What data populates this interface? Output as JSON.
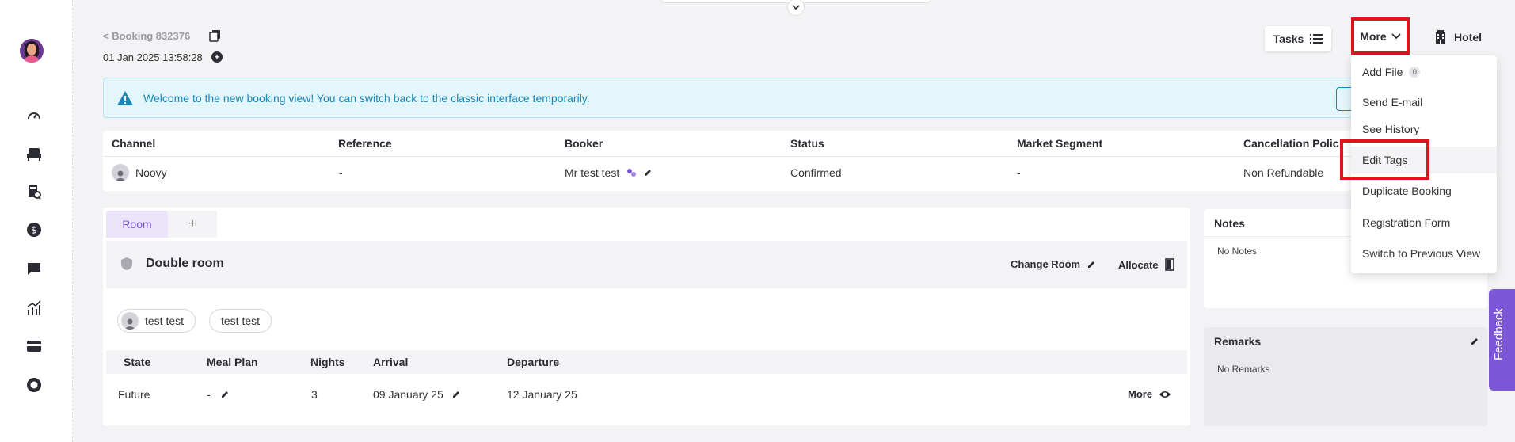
{
  "breadcrumb": {
    "back_label": "< Booking 832376"
  },
  "booking": {
    "created": "01 Jan 2025 13:58:28"
  },
  "header_actions": {
    "tasks_label": "Tasks",
    "more_label": "More",
    "hotel_label": "Hotel"
  },
  "alert": {
    "message": "Welcome to the new booking view! You can switch back to the classic interface temporarily."
  },
  "summary": {
    "headers": [
      "Channel",
      "Reference",
      "Booker",
      "Status",
      "Market Segment",
      "Cancellation Polic"
    ],
    "values": {
      "channel": "Noovy",
      "reference": "-",
      "booker": "Mr test test",
      "status": "Confirmed",
      "market_segment": "-",
      "cancellation": "Non Refundable"
    }
  },
  "room_panel": {
    "tab_room": "Room",
    "tab_add": "+",
    "room_name": "Double room",
    "change_room": "Change Room",
    "allocate": "Allocate",
    "guests": [
      "test test",
      "test test"
    ],
    "columns": [
      "State",
      "Meal Plan",
      "Nights",
      "Arrival",
      "Departure"
    ],
    "row": {
      "state": "Future",
      "meal_plan": "-",
      "nights": "3",
      "arrival": "09 January 25",
      "departure": "12 January 25",
      "more": "More"
    }
  },
  "notes": {
    "title": "Notes",
    "empty": "No Notes"
  },
  "remarks": {
    "title": "Remarks",
    "empty": "No Remarks"
  },
  "feedback": {
    "label": "Feedback"
  },
  "more_menu": {
    "items": [
      "Add File",
      "Send E-mail",
      "See History",
      "Edit Tags",
      "Duplicate Booking",
      "Registration Form",
      "Switch to Previous View"
    ],
    "file_count": "0",
    "highlighted": "Edit Tags"
  },
  "colors": {
    "accent": "#7b56d6",
    "highlight": "#e0141f",
    "alert_text": "#1a86b4",
    "alert_bg": "#e2f6fc"
  }
}
